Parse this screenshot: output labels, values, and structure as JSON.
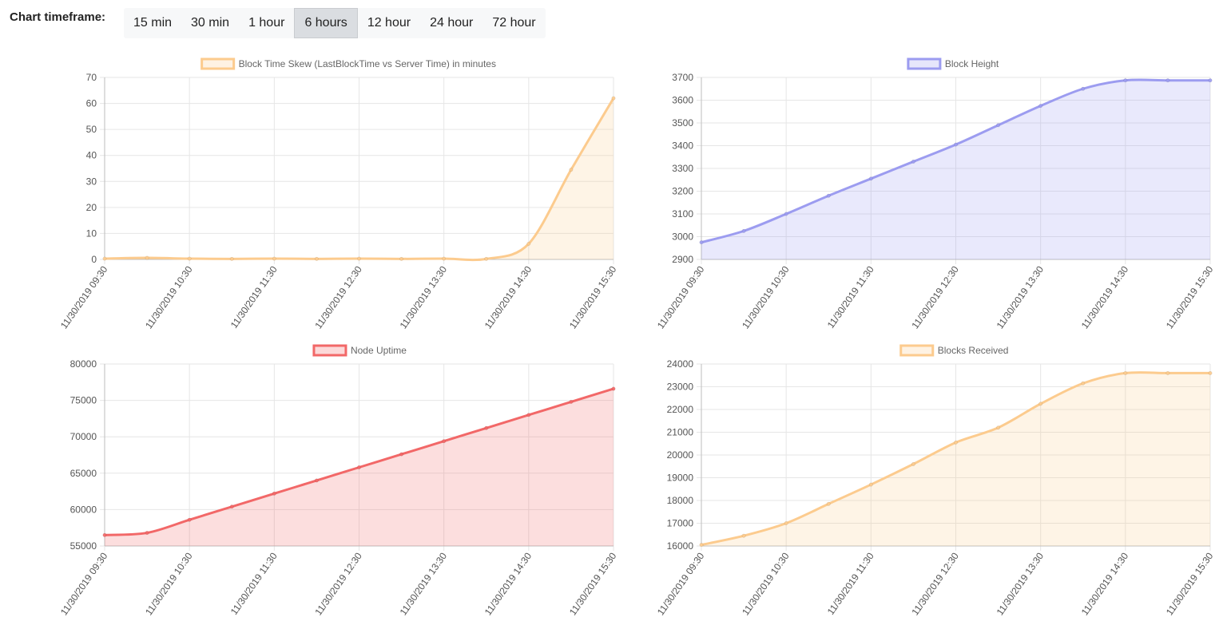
{
  "timeframe": {
    "label": "Chart timeframe:",
    "options": [
      "15 min",
      "30 min",
      "1 hour",
      "6 hours",
      "12 hour",
      "24 hour",
      "72 hour"
    ],
    "selected": "6 hours"
  },
  "chart_data": [
    {
      "type": "line",
      "fill": true,
      "series": [
        {
          "name": "Block Time Skew (LastBlockTime vs Server Time) in minutes",
          "color": "#fccb8e",
          "values": [
            0.3,
            0.6,
            0.3,
            0.2,
            0.3,
            0.2,
            0.3,
            0.2,
            0.3,
            0.2,
            6,
            34.5,
            62
          ]
        }
      ],
      "x": [
        "11/30/2019 09:30",
        "",
        "11/30/2019 10:30",
        "",
        "11/30/2019 11:30",
        "",
        "11/30/2019 12:30",
        "",
        "11/30/2019 13:30",
        "",
        "11/30/2019 14:30",
        "",
        "11/30/2019 15:30"
      ],
      "ylim": [
        0,
        70
      ],
      "yticks": [
        0,
        10,
        20,
        30,
        40,
        50,
        60,
        70
      ],
      "grid": true,
      "legend": "top-center"
    },
    {
      "type": "line",
      "fill": true,
      "series": [
        {
          "name": "Block Height",
          "color": "#9c9cf0",
          "values": [
            2975,
            3025,
            3100,
            3180,
            3255,
            3330,
            3405,
            3490,
            3575,
            3650,
            3687,
            3687,
            3687
          ]
        }
      ],
      "x": [
        "11/30/2019 09:30",
        "",
        "11/30/2019 10:30",
        "",
        "11/30/2019 11:30",
        "",
        "11/30/2019 12:30",
        "",
        "11/30/2019 13:30",
        "",
        "11/30/2019 14:30",
        "",
        "11/30/2019 15:30"
      ],
      "ylim": [
        2900,
        3700
      ],
      "yticks": [
        2900,
        3000,
        3100,
        3200,
        3300,
        3400,
        3500,
        3600,
        3700
      ],
      "grid": true,
      "legend": "top-center"
    },
    {
      "type": "line",
      "fill": true,
      "series": [
        {
          "name": "Node Uptime",
          "color": "#f26868",
          "values": [
            56500,
            56800,
            58600,
            60400,
            62200,
            64000,
            65800,
            67600,
            69400,
            71200,
            73000,
            74800,
            76600
          ]
        }
      ],
      "x": [
        "11/30/2019 09:30",
        "",
        "11/30/2019 10:30",
        "",
        "11/30/2019 11:30",
        "",
        "11/30/2019 12:30",
        "",
        "11/30/2019 13:30",
        "",
        "11/30/2019 14:30",
        "",
        "11/30/2019 15:30"
      ],
      "ylim": [
        55000,
        80000
      ],
      "yticks": [
        55000,
        60000,
        65000,
        70000,
        75000,
        80000
      ],
      "grid": true,
      "legend": "top-center"
    },
    {
      "type": "line",
      "fill": true,
      "series": [
        {
          "name": "Blocks Received",
          "color": "#fccb8e",
          "values": [
            16050,
            16450,
            17000,
            17850,
            18700,
            19600,
            20550,
            21200,
            22250,
            23150,
            23600,
            23600,
            23600
          ]
        }
      ],
      "x": [
        "11/30/2019 09:30",
        "",
        "11/30/2019 10:30",
        "",
        "11/30/2019 11:30",
        "",
        "11/30/2019 12:30",
        "",
        "11/30/2019 13:30",
        "",
        "11/30/2019 14:30",
        "",
        "11/30/2019 15:30"
      ],
      "ylim": [
        16000,
        24000
      ],
      "yticks": [
        16000,
        17000,
        18000,
        19000,
        20000,
        21000,
        22000,
        23000,
        24000
      ],
      "grid": true,
      "legend": "top-center"
    }
  ]
}
